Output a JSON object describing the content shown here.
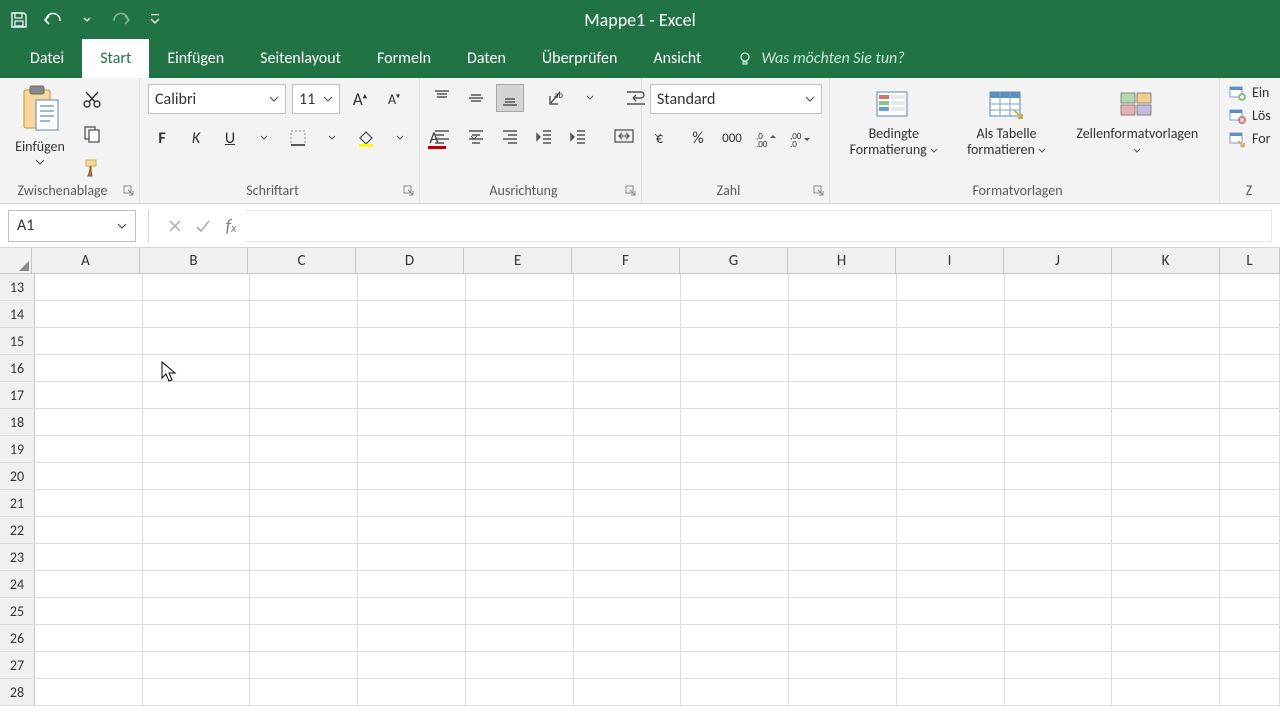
{
  "titlebar": {
    "title": "Mappe1 - Excel"
  },
  "tabs": {
    "items": [
      "Datei",
      "Start",
      "Einfügen",
      "Seitenlayout",
      "Formeln",
      "Daten",
      "Überprüfen",
      "Ansicht"
    ],
    "active_index": 1,
    "tellme": "Was möchten Sie tun?"
  },
  "ribbon": {
    "clipboard": {
      "paste": "Einfügen",
      "group_label": "Zwischenablage"
    },
    "font": {
      "name": "Calibri",
      "size": "11",
      "bold": "F",
      "italic": "K",
      "underline": "U",
      "group_label": "Schriftart"
    },
    "alignment": {
      "group_label": "Ausrichtung"
    },
    "number": {
      "format": "Standard",
      "group_label": "Zahl"
    },
    "styles": {
      "conditional": "Bedingte Formatierung",
      "as_table": "Als Tabelle formatieren",
      "cell_styles": "Zellenformatvorlagen",
      "group_label": "Formatvorlagen"
    },
    "cells": {
      "insert": "Ein",
      "delete": "Lös",
      "format": "For",
      "group_label": "Z"
    }
  },
  "namebox": {
    "value": "A1"
  },
  "grid": {
    "columns": [
      "A",
      "B",
      "C",
      "D",
      "E",
      "F",
      "G",
      "H",
      "I",
      "J",
      "K",
      "L"
    ],
    "rows": [
      13,
      14,
      15,
      16,
      17,
      18,
      19,
      20,
      21,
      22,
      23,
      24,
      25,
      26,
      27,
      28
    ]
  }
}
